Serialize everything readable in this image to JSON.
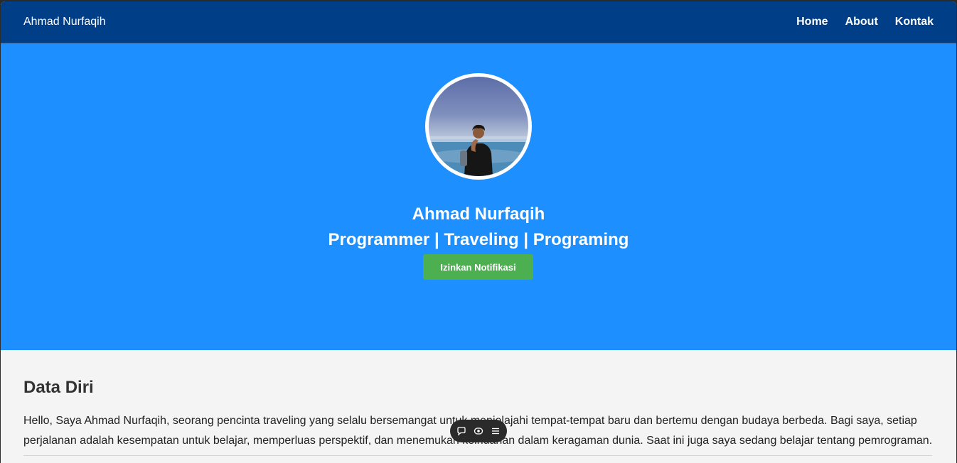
{
  "navbar": {
    "brand": "Ahmad Nurfaqih",
    "links": [
      {
        "label": "Home"
      },
      {
        "label": "About"
      },
      {
        "label": "Kontak"
      }
    ],
    "background": "#003e87"
  },
  "hero": {
    "name": "Ahmad Nurfaqih",
    "tagline": "Programmer | Traveling | Programing",
    "notify_button": "Izinkan Notifikasi",
    "background": "#1e8fff",
    "button_color": "#4caf50"
  },
  "about": {
    "title": "Data Diri",
    "text": "Hello, Saya Ahmad Nurfaqih, seorang pencinta traveling yang selalu bersemangat untuk menjelajahi tempat-tempat baru dan bertemu dengan budaya berbeda. Bagi saya, setiap perjalanan adalah kesempatan untuk belajar, memperluas perspektif, dan menemukan keindahan dalam keragaman dunia. Saat ini juga saya sedang belajar tentang pemrograman."
  },
  "floating_toolbar": {
    "icons": [
      "comment-icon",
      "view-icon",
      "menu-icon"
    ]
  }
}
